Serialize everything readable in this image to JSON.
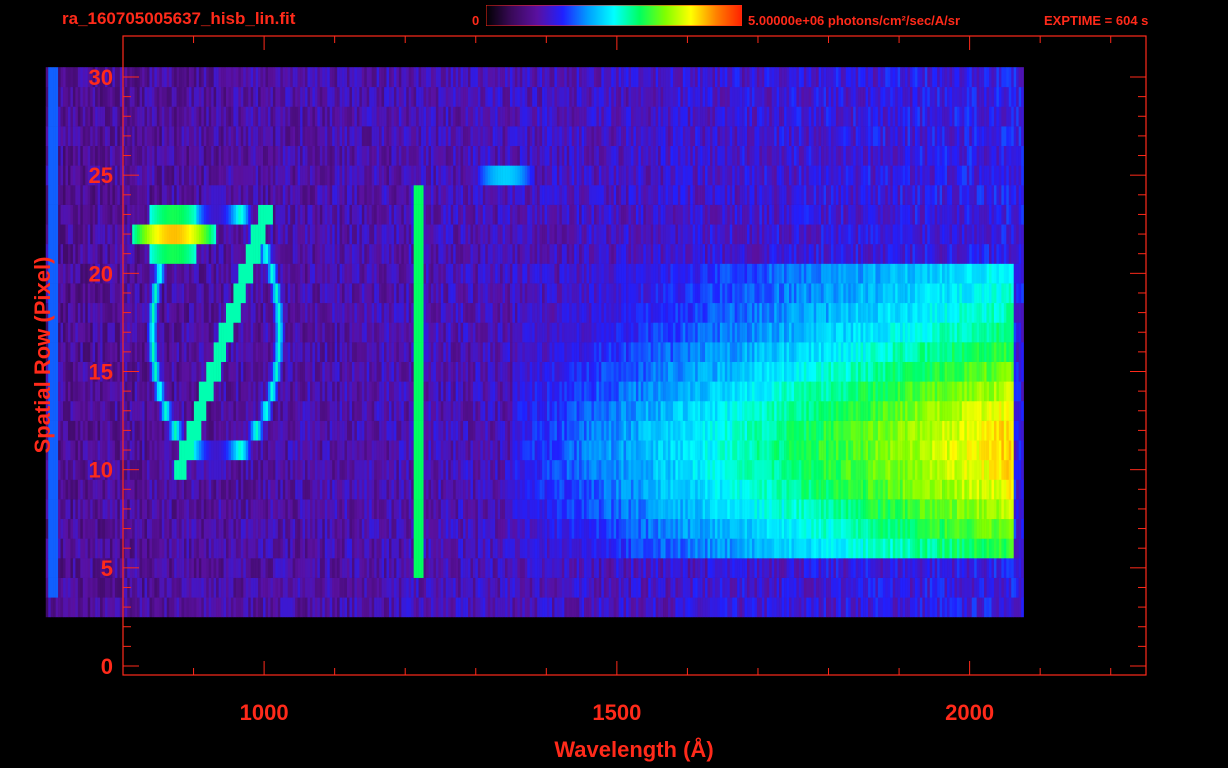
{
  "header": {
    "title": "ra_160705005637_hisb_lin.fit",
    "colorbar_min": "0",
    "colorbar_max": "5.00000e+06 photons/cm²/sec/A/sr",
    "exptime": "EXPTIME = 604 s"
  },
  "colors": {
    "axis": "#ff2a1a",
    "background": "#000000",
    "colormap": [
      "#000000",
      "#3a0a5a",
      "#5a10a0",
      "#2020ff",
      "#00a0ff",
      "#00ffff",
      "#00ff60",
      "#80ff00",
      "#ffff00",
      "#ff8000",
      "#ff2000"
    ]
  },
  "chart_data": {
    "type": "heatmap",
    "title": "ra_160705005637_hisb_lin.fit",
    "xlabel": "Wavelength (Å)",
    "ylabel": "Spatial Row (Pixel)",
    "xlim": [
      800,
      2250
    ],
    "ylim": [
      0,
      30
    ],
    "x_ticks": [
      1000,
      1500,
      2000
    ],
    "y_ticks": [
      0,
      5,
      10,
      15,
      20,
      25,
      30
    ],
    "colorbar": {
      "min": 0,
      "max": 5000000,
      "units": "photons/cm²/sec/A/sr"
    },
    "exptime_s": 604,
    "grid": false,
    "features": [
      {
        "kind": "ring",
        "cx": 930,
        "cy": 17,
        "rx": 90,
        "ry": 6.5,
        "intensity": 0.55
      },
      {
        "kind": "diagonal",
        "x0": 880,
        "y0": 10,
        "x1": 1000,
        "y1": 23,
        "intensity": 0.55
      },
      {
        "kind": "blob",
        "cx": 870,
        "cy": 22,
        "rx": 60,
        "ry": 1.2,
        "intensity": 0.85
      },
      {
        "kind": "vertical_line",
        "x": 1216,
        "y0": 5,
        "y1": 24,
        "intensity": 0.6
      },
      {
        "kind": "vertical_line",
        "x": 700,
        "y0": 4,
        "y1": 30,
        "intensity": 0.35
      },
      {
        "kind": "continuum",
        "x0": 1350,
        "x1": 2060,
        "y0": 6,
        "y1": 20,
        "peak_y": 11,
        "intensity": 0.8
      },
      {
        "kind": "blob",
        "cx": 1340,
        "cy": 25,
        "rx": 40,
        "ry": 0.6,
        "intensity": 0.45
      }
    ]
  }
}
